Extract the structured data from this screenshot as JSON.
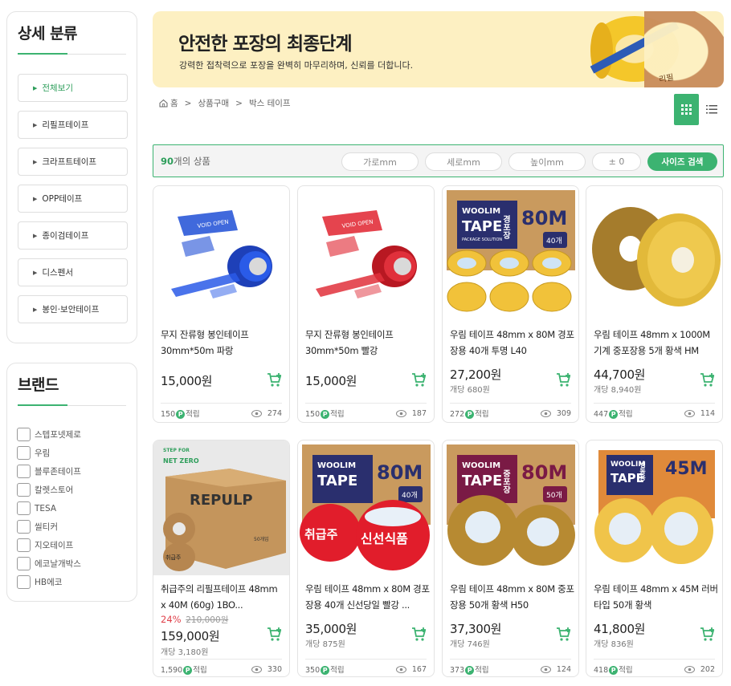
{
  "sidebar": {
    "category_title": "상세 분류",
    "categories": [
      {
        "label": "전체보기",
        "active": true
      },
      {
        "label": "리필프테이프",
        "active": false
      },
      {
        "label": "크라프트테이프",
        "active": false
      },
      {
        "label": "OPP테이프",
        "active": false
      },
      {
        "label": "종이검테이프",
        "active": false
      },
      {
        "label": "디스펜서",
        "active": false
      },
      {
        "label": "봉인·보안테이프",
        "active": false
      }
    ],
    "brand_title": "브랜드",
    "brands": [
      "스텝포넷제로",
      "우림",
      "블루존테이프",
      "칼렛스토어",
      "TESA",
      "씰티커",
      "지오테이프",
      "에코날개박스",
      "HB에코"
    ]
  },
  "banner": {
    "title": "안전한 포장의 최종단계",
    "subtitle": "강력한 접착력으로 포장을 완벽히 마무리하며, 신뢰를 더합니다.",
    "tape_text": "리필"
  },
  "breadcrumb": {
    "home": "홈",
    "sep": ">",
    "level1": "상품구매",
    "level2": "박스 테이프"
  },
  "filter": {
    "count": "90",
    "count_suffix": "개의 상품",
    "width_placeholder": "가로mm",
    "depth_placeholder": "세로mm",
    "height_placeholder": "높이mm",
    "tolerance": "± 0",
    "search_label": "사이즈 검색"
  },
  "products": [
    {
      "name": "무지 잔류형 봉인테이프 30mm*50m 파랑",
      "price": "15,000원",
      "unit": "",
      "discount": "",
      "orig_price": "",
      "points": "150",
      "points_label": "적립",
      "views": "274"
    },
    {
      "name": "무지 잔류형 봉인테이프 30mm*50m 빨강",
      "price": "15,000원",
      "unit": "",
      "discount": "",
      "orig_price": "",
      "points": "150",
      "points_label": "적립",
      "views": "187"
    },
    {
      "name": "우림 테이프 48mm x 80M 경포장용 40개 투명 L40",
      "price": "27,200원",
      "unit": "개당 680원",
      "discount": "",
      "orig_price": "",
      "points": "272",
      "points_label": "적립",
      "views": "309"
    },
    {
      "name": "우림 테이프 48mm x 1000M 기계 중포장용 5개 황색 HM",
      "price": "44,700원",
      "unit": "개당 8,940원",
      "discount": "",
      "orig_price": "",
      "points": "447",
      "points_label": "적립",
      "views": "114"
    },
    {
      "name": "취급주의 리필프테이프 48mm x 40M (60g) 1BO...",
      "price": "159,000원",
      "unit": "개당 3,180원",
      "discount": "24%",
      "orig_price": "210,000원",
      "points": "1,590",
      "points_label": "적립",
      "views": "330"
    },
    {
      "name": "우림 테이프 48mm x 80M 경포장용 40개 신선당일 빨강 ...",
      "price": "35,000원",
      "unit": "개당 875원",
      "discount": "",
      "orig_price": "",
      "points": "350",
      "points_label": "적립",
      "views": "167"
    },
    {
      "name": "우림 테이프 48mm x 80M 중포장용 50개 황색 H50",
      "price": "37,300원",
      "unit": "개당 746원",
      "discount": "",
      "orig_price": "",
      "points": "373",
      "points_label": "적립",
      "views": "124"
    },
    {
      "name": "우림 테이프 48mm x 45M 러버타입 50개 황색",
      "price": "41,800원",
      "unit": "개당 836원",
      "discount": "",
      "orig_price": "",
      "points": "418",
      "points_label": "적립",
      "views": "202"
    }
  ],
  "box_labels": {
    "woolim": "WOOLIM",
    "tape": "TAPE",
    "package": "PACKAGE SOLUTION",
    "len80": "80M",
    "len45": "45M",
    "c40": "40개",
    "c50": "50개",
    "light": "경포장",
    "medium": "중포장",
    "cold": "냉동용",
    "fresh": "신선식품",
    "care": "취급주",
    "netzero": "NET ZERO",
    "stepfor": "STEP FOR",
    "repulp": "REPULP",
    "box50": "50개입",
    "void": "VOID OPEN"
  },
  "colors": {
    "accent": "#3cb371",
    "banner_bg": "#fdf0c2",
    "discount": "#e0414b"
  }
}
